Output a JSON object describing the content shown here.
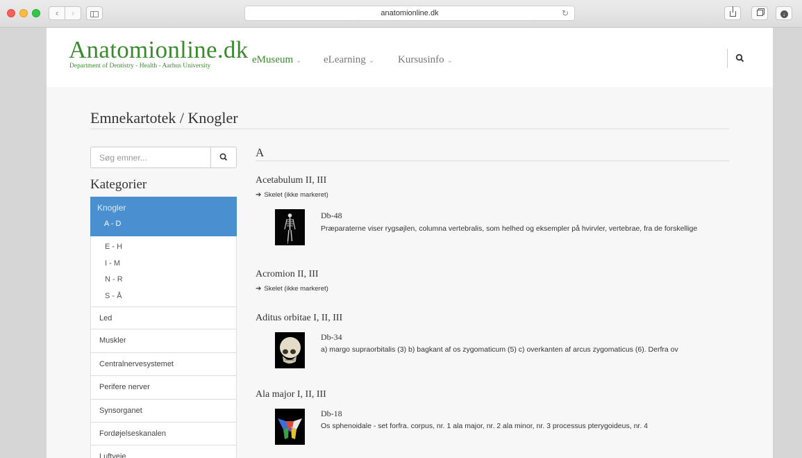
{
  "browser": {
    "url": "anatomionline.dk"
  },
  "header": {
    "logo_title": "Anatomionline.dk",
    "logo_subtitle": "Department of Dentistry - Health - Aarhus University",
    "nav": [
      {
        "label": "eMuseum"
      },
      {
        "label": "eLearning"
      },
      {
        "label": "Kursusinfo"
      }
    ]
  },
  "main": {
    "page_title": "Emnekartotek / Knogler",
    "search_placeholder": "Søg emner...",
    "categories_title": "Kategorier",
    "active_category": {
      "label": "Knogler",
      "selected_sub": "A - D",
      "subitems": [
        "E - H",
        "I - M",
        "N - R",
        "S - Å"
      ]
    },
    "categories": [
      "Led",
      "Muskler",
      "Centralnervesystemet",
      "Perifere nerver",
      "Synsorganet",
      "Fordøjelseskanalen",
      "Luftveje"
    ],
    "letter": "A",
    "entries": [
      {
        "title": "Acetabulum II, III",
        "link": "Skelet (ikke markeret)",
        "code": "Db-48",
        "description": "Præparaterne viser rygsøjlen, columna vertebralis, som helhed og eksempler på hvirvler, vertebrae, fra de forskellige"
      },
      {
        "title": "Acromion II, III",
        "link": "Skelet (ikke markeret)"
      },
      {
        "title": "Aditus orbitae I, II, III",
        "code": "Db-34",
        "description": "a) margo supraorbitalis (3) b) bagkant af os zygomaticum (5) c) overkanten af arcus zygomaticus (6). Derfra ov"
      },
      {
        "title": "Ala major I, II, III",
        "code": "Db-18",
        "description": "Os sphenoidale - set forfra. corpus, nr. 1 ala major, nr. 2 ala minor, nr. 3 processus pterygoideus, nr. 4"
      }
    ]
  }
}
